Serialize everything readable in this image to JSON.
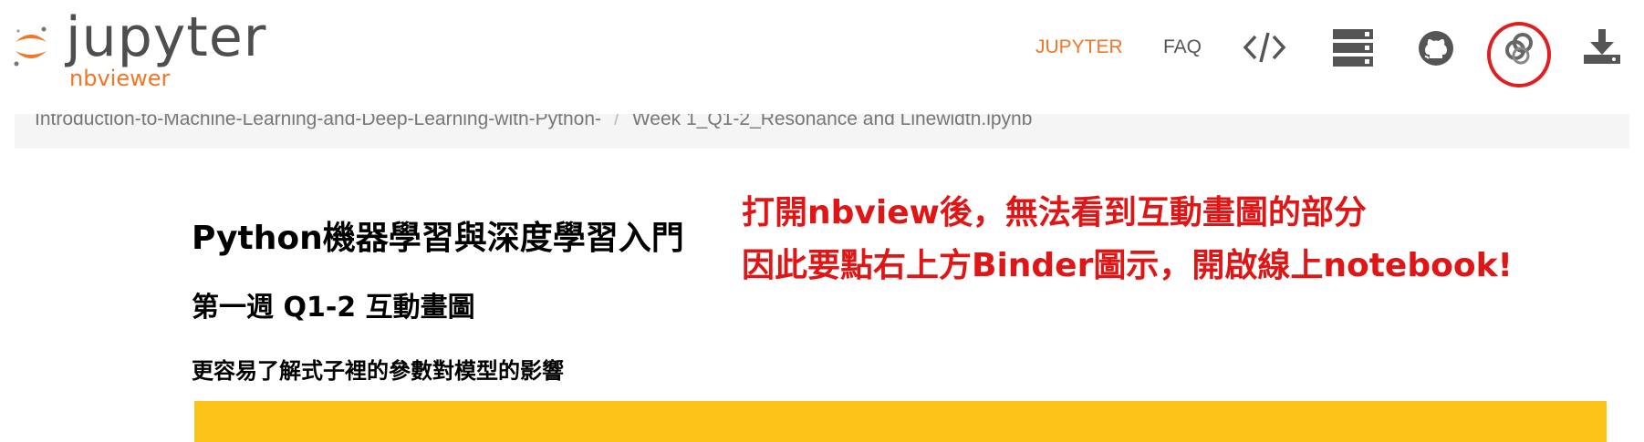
{
  "navbar": {
    "logo_word": "jupyter",
    "logo_sub": "nbviewer",
    "links": {
      "jupyter": "JUPYTER",
      "faq": "FAQ"
    },
    "icons": [
      "code-icon",
      "stack-icon",
      "github-icon",
      "binder-icon",
      "download-icon"
    ],
    "accent_color": "#f37626",
    "highlight_color": "#e02020"
  },
  "breadcrumb": {
    "repo": "Introduction-to-Machine-Learning-and-Deep-Learning-with-Python-",
    "separator": "/",
    "file": "Week 1_Q1-2_Resonance and Linewidth.ipynb"
  },
  "notebook": {
    "title": "Python機器學習與深度學習入門",
    "subtitle": "第一週 Q1-2 互動畫圖",
    "description": "更容易了解式子裡的參數對模型的影響",
    "widget_color": "#fcc419"
  },
  "annotation": {
    "line1": "打開nbview後，無法看到互動畫圖的部分",
    "line2": "因此要點右上方Binder圖示，開啟線上notebook!",
    "color": "#e01515"
  }
}
